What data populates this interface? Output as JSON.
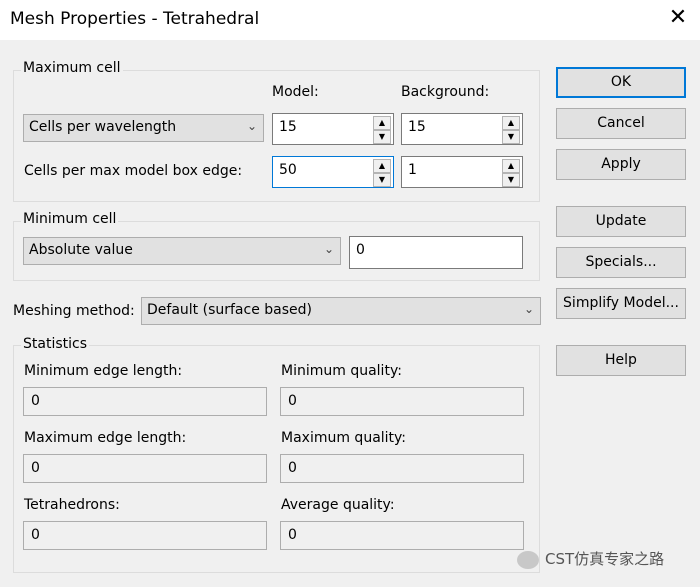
{
  "window": {
    "title": "Mesh Properties - Tetrahedral",
    "close_glyph": "✕"
  },
  "max_cell": {
    "legend": "Maximum cell",
    "model_header": "Model:",
    "background_header": "Background:",
    "row1": {
      "selector": "Cells per wavelength",
      "model": "15",
      "background": "15"
    },
    "row2": {
      "label": "Cells per max model box edge:",
      "model": "50",
      "background": "1"
    }
  },
  "min_cell": {
    "legend": "Minimum cell",
    "selector": "Absolute value",
    "value": "0"
  },
  "meshing": {
    "label": "Meshing method:",
    "value": "Default (surface based)"
  },
  "statistics": {
    "legend": "Statistics",
    "min_edge_label": "Minimum edge length:",
    "min_edge_value": "0",
    "min_quality_label": "Minimum quality:",
    "min_quality_value": "0",
    "max_edge_label": "Maximum edge length:",
    "max_edge_value": "0",
    "max_quality_label": "Maximum quality:",
    "max_quality_value": "0",
    "tetra_label": "Tetrahedrons:",
    "tetra_value": "0",
    "avg_quality_label": "Average quality:",
    "avg_quality_value": "0"
  },
  "buttons": {
    "ok": "OK",
    "cancel": "Cancel",
    "apply": "Apply",
    "update": "Update",
    "specials": "Specials...",
    "simplify": "Simplify Model...",
    "help": "Help"
  },
  "icons": {
    "dropdown": "chevron-down-icon",
    "spin_up": "up-arrow-icon",
    "spin_down": "down-arrow-icon",
    "close": "close-icon"
  },
  "watermark": {
    "text": "CST仿真专家之路"
  }
}
